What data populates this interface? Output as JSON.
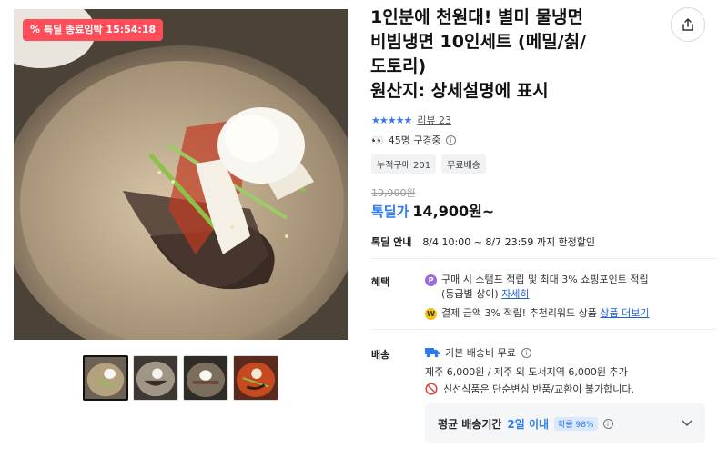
{
  "badge": {
    "label": "톡딜 종료임박 15:54:18",
    "icon": "percent-icon"
  },
  "thumbnails": [
    "thumb-1",
    "thumb-2",
    "thumb-3",
    "thumb-4"
  ],
  "title_lines": [
    "1인분에 천원대! 별미 물냉면",
    "비빔냉면 10인세트 (메밀/칡/",
    "도토리)",
    "원산지: 상세설명에 표시"
  ],
  "rating": {
    "stars": "★★★★★",
    "review_text": "리뷰 23"
  },
  "viewers": {
    "text": "45명 구경중"
  },
  "tags": [
    "누적구매 201",
    "무료배송"
  ],
  "price": {
    "original": "19,900원",
    "label": "톡딜가",
    "current": "14,900원~"
  },
  "deal_info": {
    "label": "톡딜 안내",
    "value": "8/4 10:00 ~ 8/7 23:59 까지 한정할인"
  },
  "benefits": {
    "label": "혜택",
    "line1": "구매 시 스탬프 적립 및 최대 3% 쇼핑포인트 적립",
    "line1b_prefix": "(등급별 상이)",
    "line1b_link": "자세히",
    "line2_prefix": "결제 금액 3% 적립! 추천리워드 상품",
    "line2_link": "상품 더보기"
  },
  "shipping": {
    "label": "배송",
    "line1": "기본 배송비 무료",
    "line2": "제주 6,000원 / 제주 외 도서지역 6,000원 추가",
    "line3": "신선식품은 단순변심 반품/교환이 불가합니다.",
    "avg_label": "평균 배송기간",
    "avg_value": "2일 이내",
    "avg_badge": "확률 98%"
  },
  "colors": {
    "accent": "#2b7bf0",
    "badge": "#ff4d5a",
    "link": "#1f5fd1"
  }
}
